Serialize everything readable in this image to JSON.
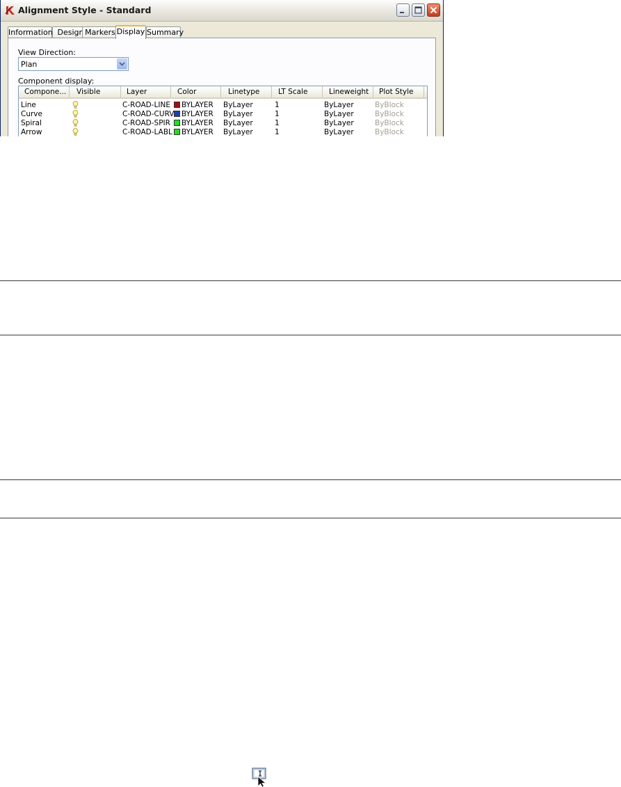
{
  "window": {
    "title": "Alignment Style - Standard",
    "controls": {
      "minimize": "minimize",
      "maximize": "maximize",
      "close": "close"
    }
  },
  "tabs": [
    {
      "label": "Information",
      "active": false
    },
    {
      "label": "Design",
      "active": false
    },
    {
      "label": "Markers",
      "active": false
    },
    {
      "label": "Display",
      "active": true
    },
    {
      "label": "Summary",
      "active": false
    }
  ],
  "display": {
    "view_direction_label": "View Direction:",
    "view_direction_value": "Plan",
    "component_display_label": "Component display:",
    "columns": [
      "Compone...",
      "Visible",
      "Layer",
      "Color",
      "Linetype",
      "LT Scale",
      "Lineweight",
      "Plot Style"
    ],
    "rows": [
      {
        "component": "Line",
        "visible": "bulb-on-icon",
        "layer": "C-ROAD-LINE",
        "color": "BYLAYER",
        "swatch": "#a01010",
        "linetype": "ByLayer",
        "lt_scale": "1",
        "lineweight": "ByLayer",
        "plot_style": "ByBlock"
      },
      {
        "component": "Curve",
        "visible": "bulb-on-icon",
        "layer": "C-ROAD-CURV",
        "color": "BYLAYER",
        "swatch": "#1f3fa8",
        "linetype": "ByLayer",
        "lt_scale": "1",
        "lineweight": "ByLayer",
        "plot_style": "ByBlock"
      },
      {
        "component": "Spiral",
        "visible": "bulb-on-icon",
        "layer": "C-ROAD-SPIR",
        "color": "BYLAYER",
        "swatch": "#22dd22",
        "linetype": "ByLayer",
        "lt_scale": "1",
        "lineweight": "ByLayer",
        "plot_style": "ByBlock"
      },
      {
        "component": "Arrow",
        "visible": "bulb-on-icon",
        "layer": "C-ROAD-LABL",
        "color": "BYLAYER",
        "swatch": "#22dd22",
        "linetype": "ByLayer",
        "lt_scale": "1",
        "lineweight": "ByLayer",
        "plot_style": "ByBlock"
      }
    ]
  },
  "colors": {
    "accent_tab": "#f1b343",
    "close_button": "#c63c1c",
    "plot_style_text": "#a39e92"
  }
}
